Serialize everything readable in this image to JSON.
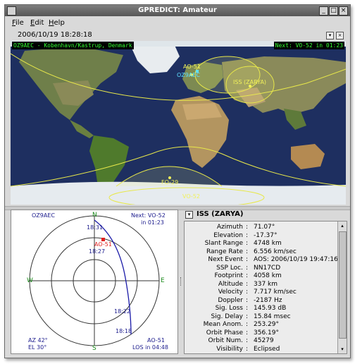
{
  "window": {
    "title": "GPREDICT: Amateur",
    "btn_minimize": "_",
    "btn_maximize": "□",
    "btn_close": "×"
  },
  "menubar": {
    "file": "File",
    "file_key": "F",
    "file_rest": "ile",
    "edit": "Edit",
    "edit_key": "E",
    "edit_rest": "dit",
    "help": "Help",
    "help_key": "H",
    "help_rest": "elp"
  },
  "clock": {
    "text": "2006/10/19 18:28:18"
  },
  "map": {
    "qth_label": "OZ9AEC - Kobenhavn/Kastrup, Denmark",
    "next_label": "Next: VO-52 in 01:23",
    "sat_ao51": "AO-51",
    "qth_marker": "OZ9AEC",
    "sat_iss": "ISS (ZARYA)",
    "sat_fo29": "FO-29",
    "sat_vo52": "VO-52",
    "colors": {
      "track": "#e8e84a",
      "label_yellow": "#f2f25a",
      "label_cyan": "#5ee0ff",
      "label_green": "#33ff33"
    }
  },
  "polar": {
    "qth": "OZ9AEC",
    "next_line1": "Next: VO-52",
    "next_line2": "in 01:23",
    "north": "N",
    "south": "S",
    "east": "E",
    "west": "W",
    "sat_name": "AO-51",
    "t1": "18:31",
    "t2": "18:27",
    "t3": "18:22",
    "t4": "18:18",
    "az": "AZ 42°",
    "el": "EL 30°",
    "bottom_sat": "AO-51",
    "los": "LOS in 04:48",
    "colors": {
      "track": "#1a1aa8",
      "sat": "#e02020",
      "compass": "#1a8a1a"
    }
  },
  "info": {
    "expander": "▾",
    "title": "ISS (ZARYA)",
    "rows": [
      {
        "k": "Azimuth",
        "v": "71.07°"
      },
      {
        "k": "Elevation",
        "v": "-17.37°"
      },
      {
        "k": "Slant Range",
        "v": "4748 km"
      },
      {
        "k": "Range Rate",
        "v": "6.556 km/sec"
      },
      {
        "k": "Next Event",
        "v": "AOS: 2006/10/19 19:47:16"
      },
      {
        "k": "SSP Loc.",
        "v": "NN17CD"
      },
      {
        "k": "Footprint",
        "v": "4058 km"
      },
      {
        "k": "Altitude",
        "v": "337 km"
      },
      {
        "k": "Velocity",
        "v": "7.717 km/sec"
      },
      {
        "k": "Doppler",
        "v": "-2187 Hz"
      },
      {
        "k": "Sig. Loss",
        "v": "145.93 dB"
      },
      {
        "k": "Sig. Delay",
        "v": "15.84 msec"
      },
      {
        "k": "Mean Anom.",
        "v": "253.29°"
      },
      {
        "k": "Orbit Phase",
        "v": "356.19°"
      },
      {
        "k": "Orbit Num.",
        "v": "45279"
      },
      {
        "k": "Visibility",
        "v": "Eclipsed"
      }
    ]
  }
}
